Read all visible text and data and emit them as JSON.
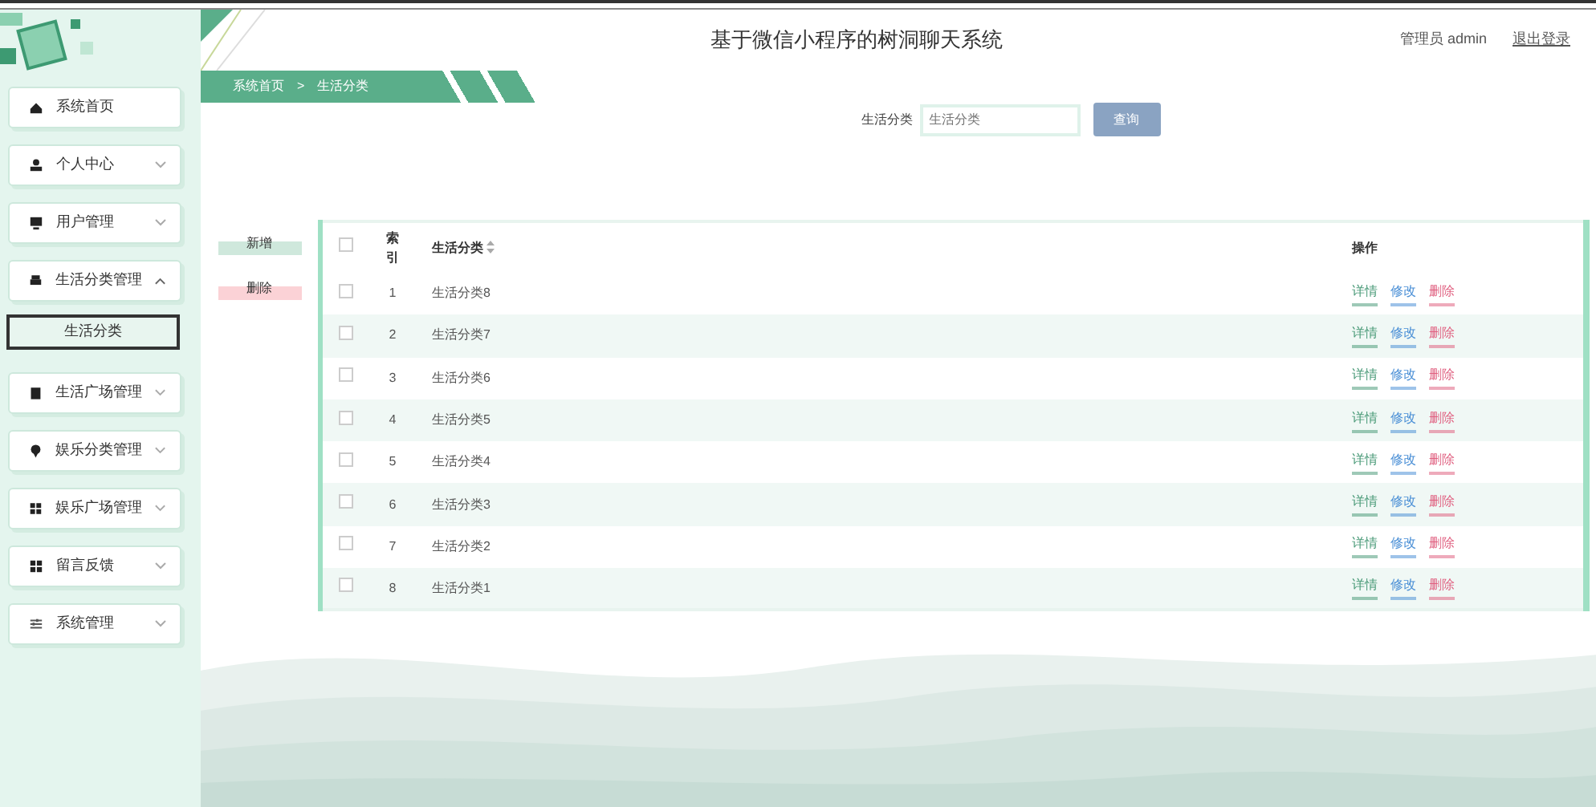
{
  "sidebar": {
    "items": [
      {
        "label": "系统首页",
        "kind": "link"
      },
      {
        "label": "个人中心",
        "kind": "menu",
        "expanded": false
      },
      {
        "label": "用户管理",
        "kind": "menu",
        "expanded": false
      },
      {
        "label": "生活分类管理",
        "kind": "menu",
        "expanded": true,
        "children": [
          {
            "label": "生活分类",
            "selected": true
          }
        ]
      },
      {
        "label": "生活广场管理",
        "kind": "menu",
        "expanded": false
      },
      {
        "label": "娱乐分类管理",
        "kind": "menu",
        "expanded": false
      },
      {
        "label": "娱乐广场管理",
        "kind": "menu",
        "expanded": false
      },
      {
        "label": "留言反馈",
        "kind": "menu",
        "expanded": false
      },
      {
        "label": "系统管理",
        "kind": "menu",
        "expanded": false
      }
    ]
  },
  "header": {
    "title": "基于微信小程序的树洞聊天系统",
    "user": "管理员 admin",
    "logout": "退出登录"
  },
  "breadcrumb": [
    "系统首页",
    ">",
    "生活分类"
  ],
  "search": {
    "label": "生活分类",
    "placeholder": "生活分类",
    "button": "查询"
  },
  "toolbar": [
    {
      "label": "新增",
      "kind": "add"
    },
    {
      "label": "删除",
      "kind": "delete"
    }
  ],
  "table": {
    "header_checked": false,
    "columns": [
      "索引",
      "生活分类",
      "操作"
    ],
    "rows": [
      {
        "index": "1",
        "name": "生活分类8",
        "checked": false,
        "actions": [
          {
            "label": "详情",
            "kind": "detail"
          },
          {
            "label": "修改",
            "kind": "edit"
          },
          {
            "label": "删除",
            "kind": "delete"
          }
        ]
      },
      {
        "index": "2",
        "name": "生活分类7",
        "checked": false,
        "actions": [
          {
            "label": "详情",
            "kind": "detail"
          },
          {
            "label": "修改",
            "kind": "edit"
          },
          {
            "label": "删除",
            "kind": "delete"
          }
        ]
      },
      {
        "index": "3",
        "name": "生活分类6",
        "checked": false,
        "actions": [
          {
            "label": "详情",
            "kind": "detail"
          },
          {
            "label": "修改",
            "kind": "edit"
          },
          {
            "label": "删除",
            "kind": "delete"
          }
        ]
      },
      {
        "index": "4",
        "name": "生活分类5",
        "checked": false,
        "actions": [
          {
            "label": "详情",
            "kind": "detail"
          },
          {
            "label": "修改",
            "kind": "edit"
          },
          {
            "label": "删除",
            "kind": "delete"
          }
        ]
      },
      {
        "index": "5",
        "name": "生活分类4",
        "checked": false,
        "actions": [
          {
            "label": "详情",
            "kind": "detail"
          },
          {
            "label": "修改",
            "kind": "edit"
          },
          {
            "label": "删除",
            "kind": "delete"
          }
        ]
      },
      {
        "index": "6",
        "name": "生活分类3",
        "checked": false,
        "actions": [
          {
            "label": "详情",
            "kind": "detail"
          },
          {
            "label": "修改",
            "kind": "edit"
          },
          {
            "label": "删除",
            "kind": "delete"
          }
        ]
      },
      {
        "index": "7",
        "name": "生活分类2",
        "checked": false,
        "actions": [
          {
            "label": "详情",
            "kind": "detail"
          },
          {
            "label": "修改",
            "kind": "edit"
          },
          {
            "label": "删除",
            "kind": "delete"
          }
        ]
      },
      {
        "index": "8",
        "name": "生活分类1",
        "checked": false,
        "actions": [
          {
            "label": "详情",
            "kind": "detail"
          },
          {
            "label": "修改",
            "kind": "edit"
          },
          {
            "label": "删除",
            "kind": "delete"
          }
        ]
      }
    ]
  }
}
